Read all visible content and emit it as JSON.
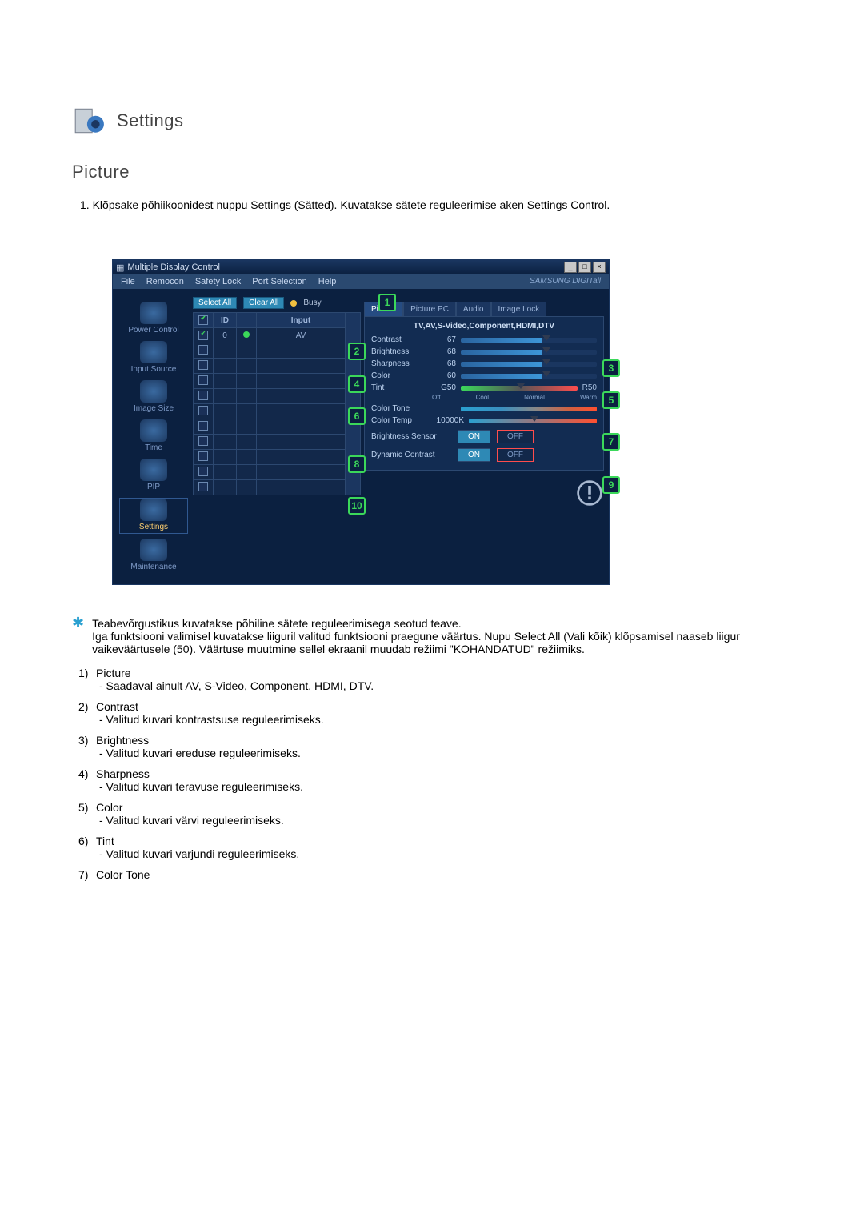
{
  "header": {
    "title": "Settings"
  },
  "section": {
    "title": "Picture"
  },
  "intro": {
    "num": "1.",
    "text": "Klõpsake põhiikoonidest nuppu Settings (Sätted). Kuvatakse sätete reguleerimise aken Settings Control."
  },
  "app": {
    "title": "Multiple Display Control",
    "menu": {
      "file": "File",
      "remocon": "Remocon",
      "safety": "Safety Lock",
      "port": "Port Selection",
      "help": "Help"
    },
    "brand": "SAMSUNG DIGITall",
    "sidebar": {
      "power": "Power Control",
      "input": "Input Source",
      "image": "Image Size",
      "time": "Time",
      "pip": "PIP",
      "settings": "Settings",
      "maint": "Maintenance"
    },
    "toolbar": {
      "select_all": "Select All",
      "clear_all": "Clear All",
      "busy": "Busy"
    },
    "grid": {
      "h_id": "ID",
      "h_input": "Input",
      "row_id": "0",
      "row_input": "AV"
    },
    "tabs": {
      "picture": "Picture",
      "picture_pc": "Picture PC",
      "audio": "Audio",
      "image_lock": "Image Lock"
    },
    "panel": {
      "subtitle": "TV,AV,S-Video,Component,HDMI,DTV",
      "contrast_l": "Contrast",
      "contrast_v": "67",
      "brightness_l": "Brightness",
      "brightness_v": "68",
      "sharpness_l": "Sharpness",
      "sharpness_v": "68",
      "color_l": "Color",
      "color_v": "60",
      "tint_l": "Tint",
      "tint_g": "G50",
      "tint_r": "R50",
      "tone_l": "Color Tone",
      "tone_off": "Off",
      "tone_cool": "Cool",
      "tone_normal": "Normal",
      "tone_warm": "Warm",
      "temp_l": "Color Temp",
      "temp_v": "10000K",
      "bsensor_l": "Brightness Sensor",
      "dyn_l": "Dynamic Contrast",
      "on": "ON",
      "off": "OFF"
    },
    "callouts": {
      "c1": "1",
      "c2": "2",
      "c3": "3",
      "c4": "4",
      "c5": "5",
      "c6": "6",
      "c7": "7",
      "c8": "8",
      "c9": "9",
      "c10": "10"
    }
  },
  "note": {
    "p1": "Teabevõrgustikus kuvatakse põhiline sätete reguleerimisega seotud teave.",
    "p2": "Iga funktsiooni valimisel kuvatakse liiguril valitud funktsiooni praegune väärtus. Nupu Select All (Vali kõik) klõpsamisel naaseb liigur vaikeväärtusele (50). Väärtuse muutmine sellel ekraanil muudab režiimi \"KOHANDATUD\" režiimiks."
  },
  "list": {
    "i1n": "1)",
    "i1t": "Picture",
    "i1s": "- Saadaval ainult AV, S-Video, Component, HDMI, DTV.",
    "i2n": "2)",
    "i2t": "Contrast",
    "i2s": "- Valitud kuvari kontrastsuse reguleerimiseks.",
    "i3n": "3)",
    "i3t": "Brightness",
    "i3s": "- Valitud kuvari ereduse reguleerimiseks.",
    "i4n": "4)",
    "i4t": "Sharpness",
    "i4s": "- Valitud kuvari teravuse reguleerimiseks.",
    "i5n": "5)",
    "i5t": "Color",
    "i5s": "- Valitud kuvari värvi reguleerimiseks.",
    "i6n": "6)",
    "i6t": "Tint",
    "i6s": "- Valitud kuvari varjundi reguleerimiseks.",
    "i7n": "7)",
    "i7t": "Color Tone"
  }
}
